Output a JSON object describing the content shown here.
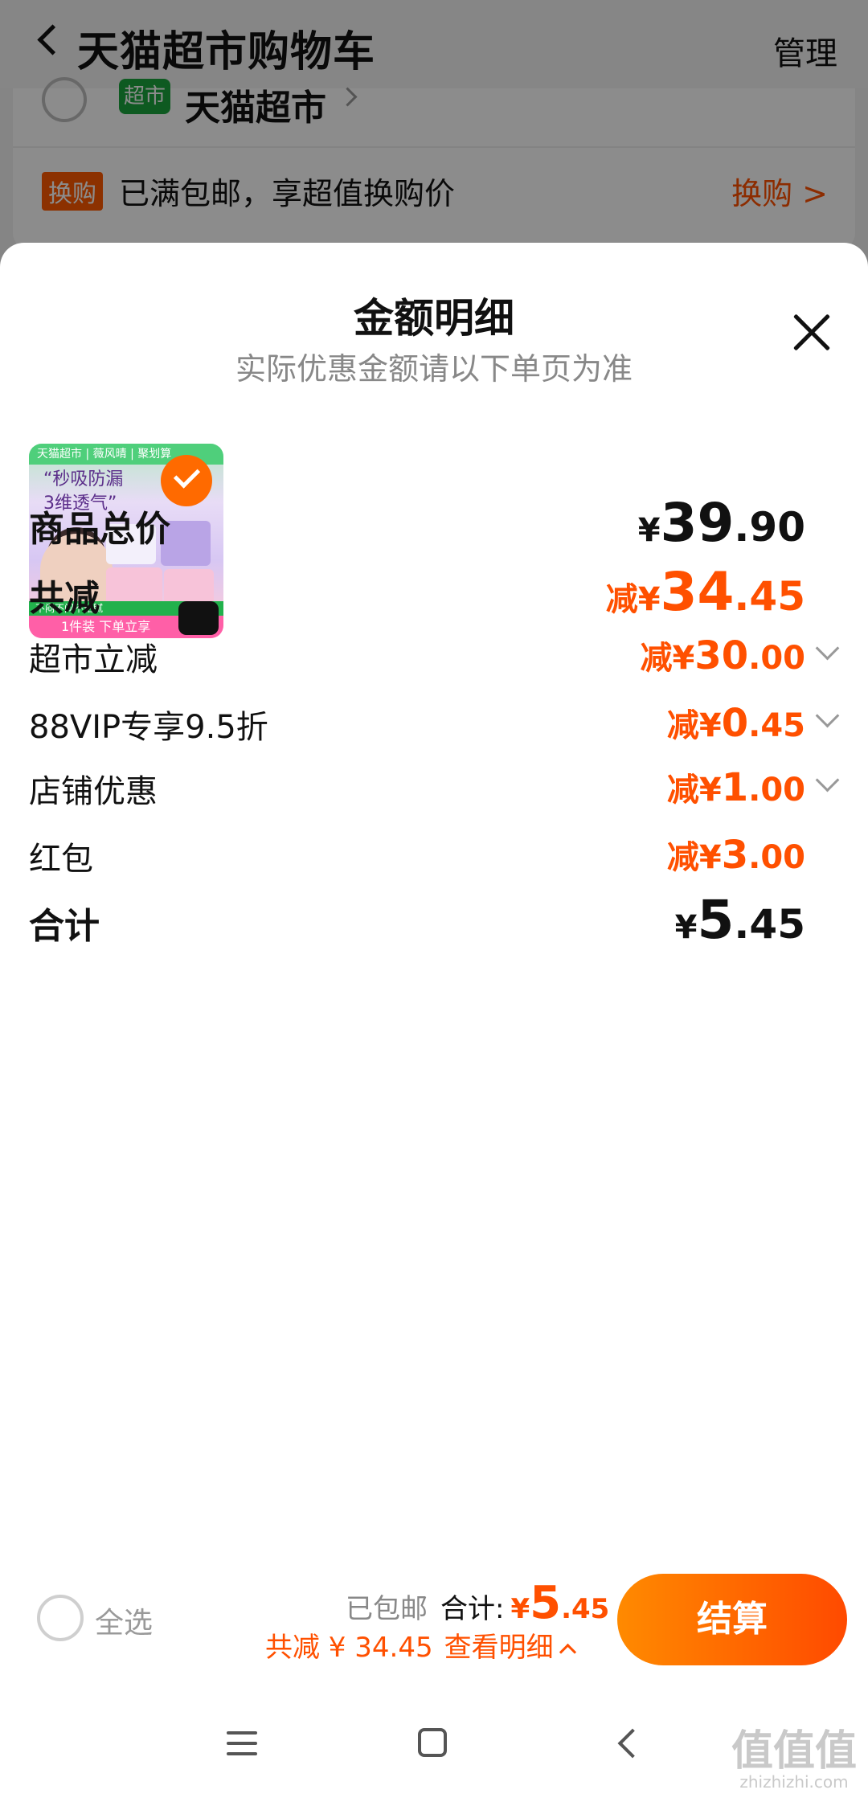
{
  "header": {
    "title": "天猫超市购物车",
    "manage": "管理"
  },
  "shop": {
    "name": "天猫超市",
    "logo_text": "超市"
  },
  "exchange": {
    "tag": "换购",
    "text": "已满包邮，享超值换购价",
    "link": "换购 >"
  },
  "sheet": {
    "title": "金额明细",
    "subtitle": "实际优惠金额请以下单页为准",
    "product_image": {
      "header": "天猫超市 | 薇风晴 | 聚划算",
      "slogan_line1": "“秒吸防漏",
      "slogan_line2": "3维透气”",
      "promo": "不闷不闷不粘腻",
      "strip": "1件装 下单立享"
    },
    "rows": [
      {
        "label": "商品总价",
        "prefix": "¥",
        "int": "39",
        "dec": ".90",
        "style": "black",
        "chevron": false
      },
      {
        "label": "共减",
        "prefix": "减¥",
        "int": "34",
        "dec": ".45",
        "style": "orange",
        "chevron": false
      },
      {
        "label": "超市立减",
        "prefix": "减¥",
        "int": "30",
        "dec": ".00",
        "style": "orange",
        "chevron": true
      },
      {
        "label": "88VIP专享9.5折",
        "prefix": "减¥",
        "int": "0",
        "dec": ".45",
        "style": "orange",
        "chevron": true
      },
      {
        "label": "店铺优惠",
        "prefix": "减¥",
        "int": "1",
        "dec": ".00",
        "style": "orange",
        "chevron": true
      },
      {
        "label": "红包",
        "prefix": "减¥",
        "int": "3",
        "dec": ".00",
        "style": "orange",
        "chevron": false
      },
      {
        "label": "合计",
        "prefix": "¥",
        "int": "5",
        "dec": ".45",
        "style": "black",
        "chevron": false
      }
    ]
  },
  "bottom": {
    "select_all": "全选",
    "free_shipping": "已包邮",
    "total_label": "合计:",
    "total_yen": "¥",
    "total_int": "5",
    "total_dec": ".45",
    "discount": "共减 ¥ 34.45",
    "detail": "查看明细",
    "checkout": "结算"
  },
  "watermark": {
    "main": "值值值",
    "sub": "zhizhizhi.com"
  },
  "colors": {
    "accent": "#ff5000",
    "checkout_from": "#ff8a00",
    "checkout_to": "#ff4a00"
  }
}
